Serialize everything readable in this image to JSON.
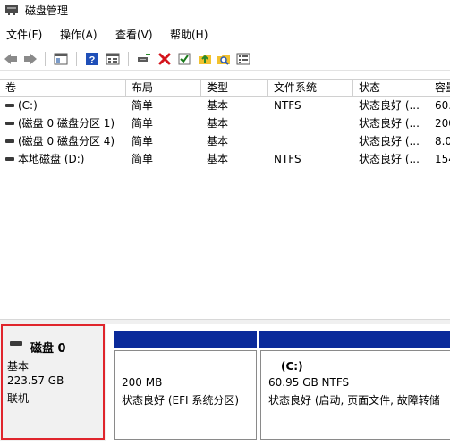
{
  "window": {
    "title": "磁盘管理"
  },
  "menu": [
    "文件(F)",
    "操作(A)",
    "查看(V)",
    "帮助(H)"
  ],
  "volumes": {
    "headers": [
      "卷",
      "布局",
      "类型",
      "文件系统",
      "状态",
      "容量"
    ],
    "rows": [
      {
        "name": "(C:)",
        "layout": "简单",
        "type": "基本",
        "fs": "NTFS",
        "status": "状态良好 (...",
        "capacity": "60."
      },
      {
        "name": "(磁盘 0 磁盘分区 1)",
        "layout": "简单",
        "type": "基本",
        "fs": "",
        "status": "状态良好 (...",
        "capacity": "200"
      },
      {
        "name": "(磁盘 0 磁盘分区 4)",
        "layout": "简单",
        "type": "基本",
        "fs": "",
        "status": "状态良好 (...",
        "capacity": "8.0"
      },
      {
        "name": "本地磁盘 (D:)",
        "layout": "简单",
        "type": "基本",
        "fs": "NTFS",
        "status": "状态良好 (...",
        "capacity": "154"
      }
    ]
  },
  "disk0": {
    "name": "磁盘 0",
    "type": "基本",
    "size": "223.57 GB",
    "state": "联机",
    "partitions": [
      {
        "label": "",
        "size": "200 MB",
        "status": "状态良好 (EFI 系统分区)"
      },
      {
        "label": "(C:)",
        "size": "60.95 GB NTFS",
        "status": "状态良好 (启动, 页面文件, 故障转储"
      }
    ]
  },
  "colors": {
    "partition_bar": "#0a2a9a",
    "highlight": "#e0252c",
    "delete_icon": "#d4141c"
  }
}
